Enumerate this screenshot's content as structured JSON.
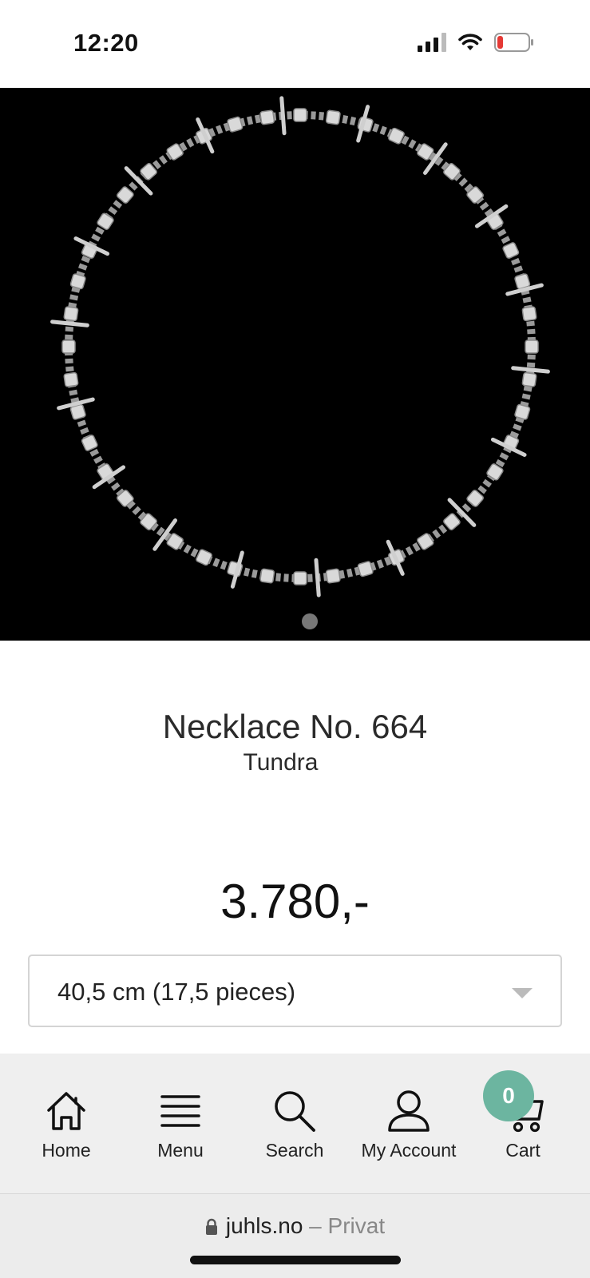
{
  "status_bar": {
    "time": "12:20",
    "icons": [
      "cellular-signal-icon",
      "wifi-icon",
      "battery-low-icon"
    ],
    "battery_color": "#e53935"
  },
  "product": {
    "image_alt": "silver necklace",
    "title": "Necklace No. 664",
    "collection": "Tundra",
    "price": "3.780,-",
    "image_pager": {
      "current": 1,
      "total": 1
    }
  },
  "size_select": {
    "selected": "40,5 cm (17,5 pieces)"
  },
  "bottom_nav": {
    "items": [
      {
        "label": "Home",
        "icon": "home-icon"
      },
      {
        "label": "Menu",
        "icon": "menu-icon"
      },
      {
        "label": "Search",
        "icon": "search-icon"
      },
      {
        "label": "My Account",
        "icon": "user-icon"
      },
      {
        "label": "Cart",
        "icon": "cart-icon"
      }
    ],
    "cart_count": "0",
    "badge_color": "#6cb5a0"
  },
  "browser": {
    "domain": "juhls.no",
    "separator": "–",
    "mode": "Privat"
  }
}
